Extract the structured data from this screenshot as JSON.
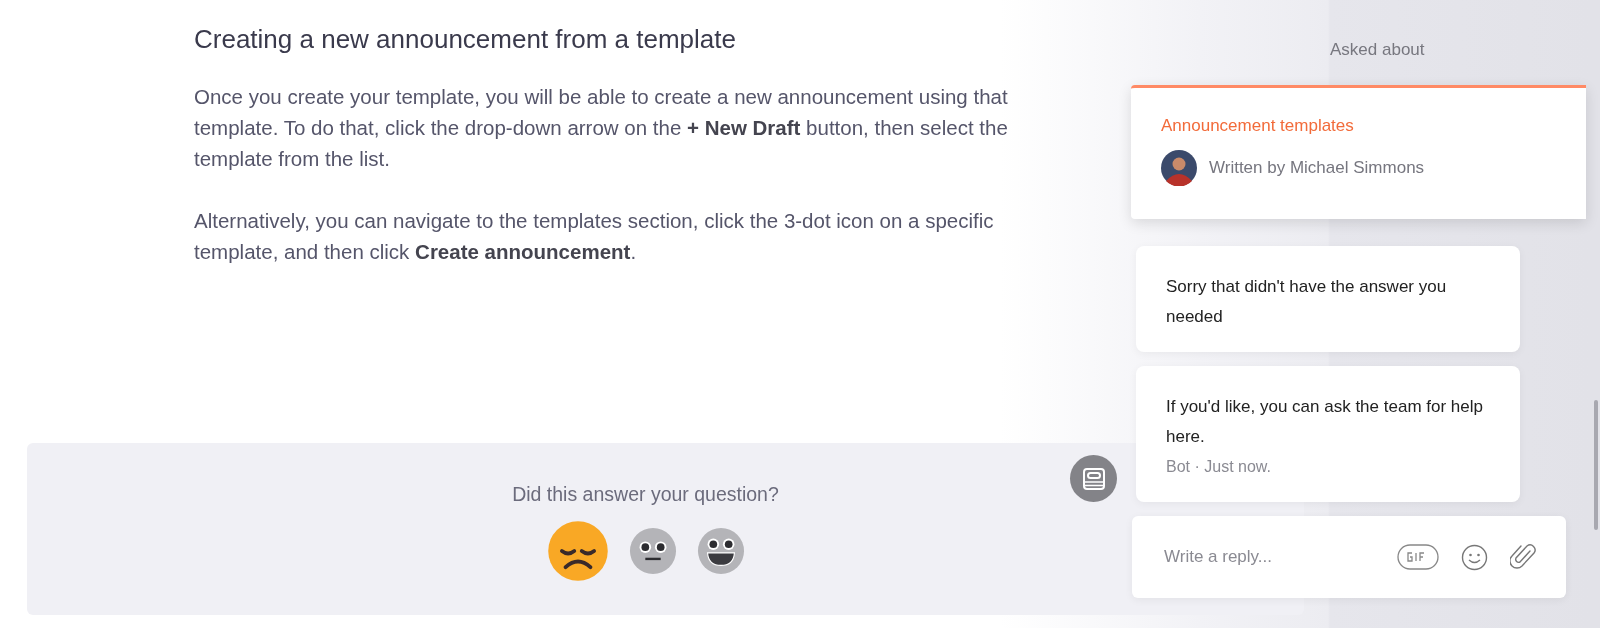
{
  "article": {
    "heading": "Creating a new announcement from a template",
    "paragraphs": [
      "Once you create your template, you will be able to create a new announcement using that template. To do that, click the drop-down arrow on the **+ New Draft** button, then select the template from the list.",
      "Alternatively, you can navigate to the templates section, click the 3-dot icon on a specific template, and then click **Create announcement**."
    ]
  },
  "feedback": {
    "question": "Did this answer your question?",
    "reactions": [
      {
        "kind": "disappointed",
        "selected": true
      },
      {
        "kind": "neutral",
        "selected": false
      },
      {
        "kind": "smiley",
        "selected": false
      }
    ]
  },
  "messenger": {
    "section_title": "Asked about",
    "article_card": {
      "title": "Announcement templates",
      "author": "Written by Michael Simmons"
    },
    "messages": [
      {
        "text": "Sorry that didn't have the answer you needed"
      },
      {
        "text": "If you'd like, you can ask the team for help here.",
        "meta": "Bot · Just now."
      }
    ],
    "composer": {
      "placeholder": "Write a reply..."
    }
  }
}
